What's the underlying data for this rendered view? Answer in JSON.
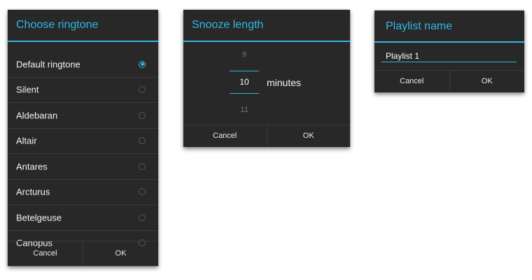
{
  "ringtone_dialog": {
    "title": "Choose ringtone",
    "items": [
      {
        "label": "Default ringtone",
        "selected": true
      },
      {
        "label": "Silent",
        "selected": false
      },
      {
        "label": "Aldebaran",
        "selected": false
      },
      {
        "label": "Altair",
        "selected": false
      },
      {
        "label": "Antares",
        "selected": false
      },
      {
        "label": "Arcturus",
        "selected": false
      },
      {
        "label": "Betelgeuse",
        "selected": false
      },
      {
        "label": "Canopus",
        "selected": false
      }
    ],
    "cancel_label": "Cancel",
    "ok_label": "OK"
  },
  "snooze_dialog": {
    "title": "Snooze length",
    "previous_value": "9",
    "current_value": "10",
    "next_value": "11",
    "unit": "minutes",
    "cancel_label": "Cancel",
    "ok_label": "OK"
  },
  "playlist_dialog": {
    "title": "Playlist name",
    "name_value": "Playlist 1",
    "cancel_label": "Cancel",
    "ok_label": "OK"
  },
  "colors": {
    "accent": "#33b5e5",
    "dialog_background": "#282828",
    "divider": "#3a3a3a"
  }
}
